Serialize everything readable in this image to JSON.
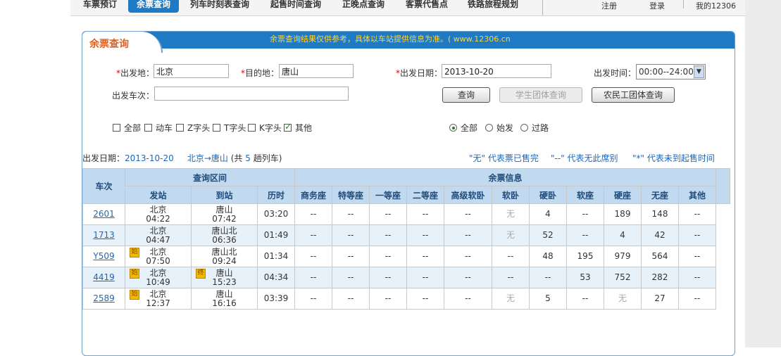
{
  "nav": {
    "items": [
      "车票预订",
      "余票查询",
      "列车时刻表查询",
      "起售时间查询",
      "正晚点查询",
      "客票代售点",
      "铁路旅程规划"
    ],
    "right": [
      "注册",
      "登录",
      "我的12306"
    ]
  },
  "panel": {
    "title": "余票查询",
    "notice": "余票查询结果仅供参考，具体以车站提供信息为准。( www.12306.cn"
  },
  "form": {
    "from_label": "出发地：",
    "from_value": "北京",
    "to_label": "目的地：",
    "to_value": "唐山",
    "date_label": "出发日期：",
    "date_value": "2013-10-20",
    "time_label": "出发时间：",
    "time_value": "00:00--24:00",
    "train_label": "出发车次：",
    "train_value": "",
    "query_button": "查询",
    "student_button": "学生团体查询",
    "worker_button": "农民工团体查询",
    "required_mark": "*"
  },
  "filters": {
    "types": [
      {
        "label": "全部",
        "checked": false
      },
      {
        "label": "动车",
        "checked": false
      },
      {
        "label": "Z字头",
        "checked": false
      },
      {
        "label": "T字头",
        "checked": false
      },
      {
        "label": "K字头",
        "checked": false
      },
      {
        "label": "其他",
        "checked": true
      }
    ],
    "origin": [
      {
        "label": "全部",
        "selected": true
      },
      {
        "label": "始发",
        "selected": false
      },
      {
        "label": "过路",
        "selected": false
      }
    ]
  },
  "summary": {
    "date_prefix": "出发日期：",
    "date": "2013-10-20",
    "route": "北京→唐山",
    "count_prefix": "(共",
    "count": "5",
    "count_suffix": "趟列车)",
    "legend_none": "\"无\" 代表票已售完",
    "legend_dash": "\"--\" 代表无此席别",
    "legend_star": "\"*\" 代表未到起售时间"
  },
  "table": {
    "group_headers": {
      "train": "车次",
      "section": "查询区间",
      "tickets": "余票信息"
    },
    "headers": [
      "发站",
      "到站",
      "历时",
      "商务座",
      "特等座",
      "一等座",
      "二等座",
      "高级软卧",
      "软卧",
      "硬卧",
      "软座",
      "硬座",
      "无座",
      "其他"
    ],
    "rows": [
      {
        "train": "2601",
        "from": "北京",
        "dep": "04:22",
        "to": "唐山",
        "arr": "07:42",
        "dur": "03:20",
        "from_badge": "",
        "to_badge": "",
        "seats": [
          "--",
          "--",
          "--",
          "--",
          "--",
          "无",
          "4",
          "--",
          "189",
          "148",
          "--"
        ]
      },
      {
        "train": "1713",
        "from": "北京",
        "dep": "04:47",
        "to": "唐山北",
        "arr": "06:36",
        "dur": "01:49",
        "from_badge": "",
        "to_badge": "",
        "seats": [
          "--",
          "--",
          "--",
          "--",
          "--",
          "无",
          "52",
          "--",
          "4",
          "42",
          "--"
        ]
      },
      {
        "train": "Y509",
        "from": "北京",
        "dep": "07:50",
        "to": "唐山北",
        "arr": "09:24",
        "dur": "01:34",
        "from_badge": "始",
        "to_badge": "",
        "seats": [
          "--",
          "--",
          "--",
          "--",
          "--",
          "--",
          "48",
          "195",
          "979",
          "564",
          "--"
        ]
      },
      {
        "train": "4419",
        "from": "北京",
        "dep": "10:49",
        "to": "唐山",
        "arr": "15:23",
        "dur": "04:34",
        "from_badge": "始",
        "to_badge": "终",
        "seats": [
          "--",
          "--",
          "--",
          "--",
          "--",
          "--",
          "--",
          "53",
          "752",
          "282",
          "--"
        ]
      },
      {
        "train": "2589",
        "from": "北京",
        "dep": "12:37",
        "to": "唐山",
        "arr": "16:16",
        "dur": "03:39",
        "from_badge": "始",
        "to_badge": "",
        "seats": [
          "--",
          "--",
          "--",
          "--",
          "--",
          "无",
          "5",
          "--",
          "无",
          "27",
          "--"
        ]
      }
    ]
  }
}
